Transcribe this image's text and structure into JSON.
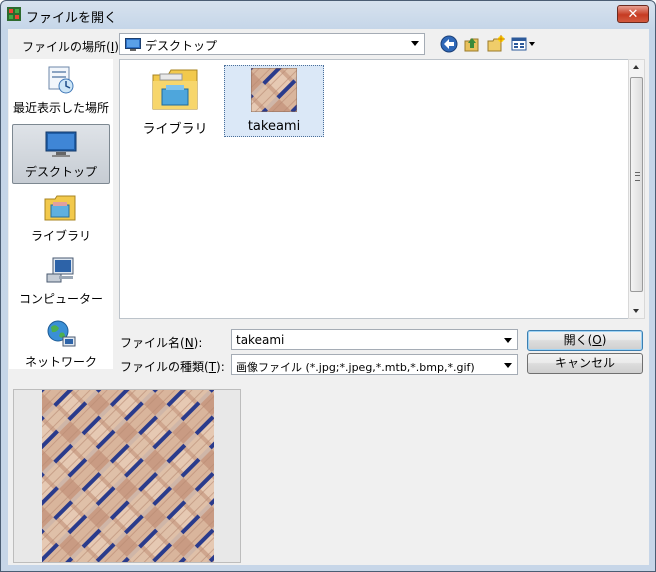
{
  "window": {
    "title": "ファイルを開く",
    "close_label": "✕"
  },
  "look_in": {
    "label_pre": "ファイルの場所(",
    "label_key": "I",
    "label_post": "):",
    "value": "デスクトップ"
  },
  "toolbar": {
    "back_icon": "back-arrow-icon",
    "up_icon": "up-folder-icon",
    "new_folder_icon": "new-folder-icon",
    "views_icon": "views-menu-icon"
  },
  "places": [
    {
      "label": "最近表示した場所",
      "icon": "recent-places-icon"
    },
    {
      "label": "デスクトップ",
      "icon": "desktop-icon",
      "selected": true
    },
    {
      "label": "ライブラリ",
      "icon": "library-icon"
    },
    {
      "label": "コンピューター",
      "icon": "computer-icon"
    },
    {
      "label": "ネットワーク",
      "icon": "network-icon"
    }
  ],
  "files": [
    {
      "name": "ライブラリ",
      "icon": "library-folder-icon"
    },
    {
      "name": "takeami",
      "icon": "image-thumbnail-icon",
      "selected": true
    }
  ],
  "filename": {
    "label_pre": "ファイル名(",
    "label_key": "N",
    "label_post": "):",
    "value": "takeami"
  },
  "filetype": {
    "label_pre": "ファイルの種類(",
    "label_key": "T",
    "label_post": "):",
    "value": "画像ファイル (*.jpg;*.jpeg,*.mtb,*.bmp,*.gif)"
  },
  "buttons": {
    "open_pre": "開く(",
    "open_key": "O",
    "open_post": ")",
    "cancel": "キャンセル"
  },
  "colors": {
    "selection_bg": "#dbe8f7",
    "weave_light": "#d9b59c",
    "weave_gap": "#2a3b8c"
  }
}
